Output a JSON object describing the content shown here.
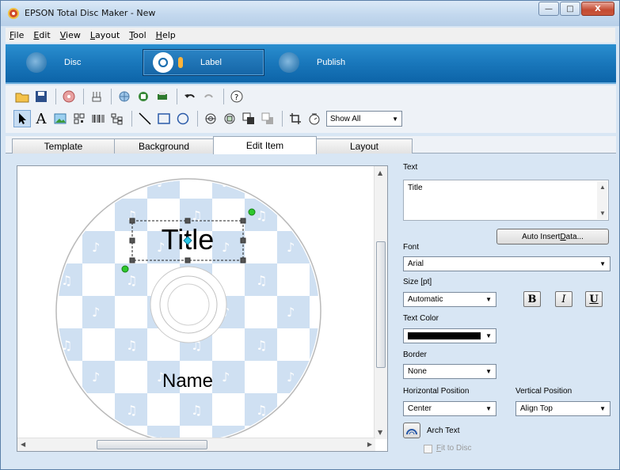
{
  "window": {
    "title": "EPSON Total Disc Maker - New",
    "buttons": {
      "minimize": "—",
      "maximize": "□",
      "close": "X"
    }
  },
  "menu": [
    {
      "accel": "F",
      "rest": "ile"
    },
    {
      "accel": "E",
      "rest": "dit"
    },
    {
      "accel": "V",
      "rest": "iew"
    },
    {
      "accel": "L",
      "rest": "ayout"
    },
    {
      "accel": "T",
      "rest": "ool"
    },
    {
      "accel": "H",
      "rest": "elp"
    }
  ],
  "modes": {
    "disc": "Disc",
    "label": "Label",
    "publish": "Publish"
  },
  "toolbar": {
    "row1_icons": [
      "open-folder-icon",
      "save-icon",
      "disc-icon",
      "tools-icon",
      "globe-icon",
      "print-layout-icon",
      "printer-icon",
      "undo-icon",
      "redo-icon",
      "help-icon"
    ],
    "row2_icons": [
      "select-arrow-icon",
      "text-tool-icon",
      "image-tool-icon",
      "qr-code-icon",
      "barcode-icon",
      "tree-icon",
      "line-tool-icon",
      "rectangle-tool-icon",
      "ellipse-tool-icon",
      "disc-ring-icon",
      "group-icon",
      "bring-front-icon",
      "send-back-icon",
      "crop-icon",
      "rotate-icon"
    ],
    "show_all": "Show All"
  },
  "tabs": [
    "Template",
    "Background",
    "Edit Item",
    "Layout"
  ],
  "active_tab": "Edit Item",
  "canvas": {
    "title_text": "Title",
    "name_text": "Name",
    "pattern_color": "#cfe0f2",
    "handle_color": "#555555",
    "rotate_handle_color": "#2ec82e",
    "center_handle_color": "#29c7e6"
  },
  "props": {
    "text_label": "Text",
    "text_value": "Title",
    "auto_insert_prefix": "Auto Insert ",
    "auto_insert_accel": "D",
    "auto_insert_suffix": "ata...",
    "font_label": "Font",
    "font_value": "Arial",
    "size_label": "Size [pt]",
    "size_value": "Automatic",
    "bold": "B",
    "italic": "I",
    "underline": "U",
    "text_color_label": "Text Color",
    "text_color_value": "#000000",
    "border_label": "Border",
    "border_value": "None",
    "hpos_label": "Horizontal Position",
    "hpos_value": "Center",
    "vpos_label": "Vertical Position",
    "vpos_value": "Align Top",
    "arch_text": "Arch Text",
    "fit_prefix": "F",
    "fit_rest": "it to Disc"
  }
}
